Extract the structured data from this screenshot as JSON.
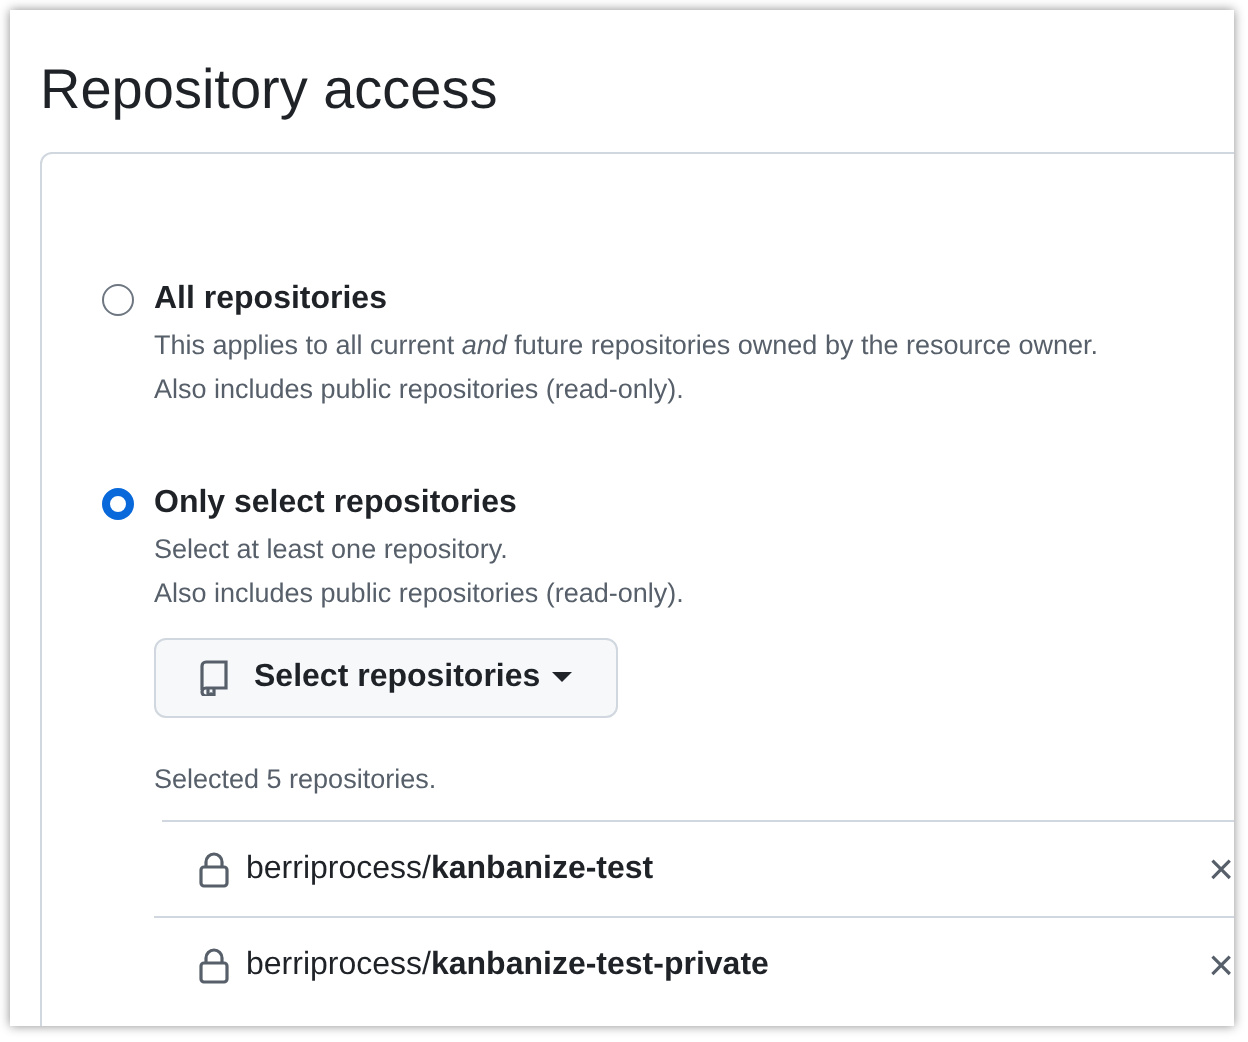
{
  "title": "Repository access",
  "options": [
    {
      "label": "All repositories",
      "selected": false,
      "description": [
        "This applies to all current *and* future repositories owned by the resource owner.",
        "Also includes public repositories (read-only)."
      ]
    },
    {
      "label": "Only select repositories",
      "selected": true,
      "description": [
        "Select at least one repository.",
        "Also includes public repositories (read-only)."
      ]
    }
  ],
  "select_button": {
    "label": "Select repositories"
  },
  "selected_count": "Selected 5 repositories.",
  "repositories": [
    {
      "name": "berriprocess/**kanbanize-test**",
      "remove": "×"
    },
    {
      "name": "berriprocess/**kanbanize-test-private**",
      "remove": "×"
    }
  ]
}
